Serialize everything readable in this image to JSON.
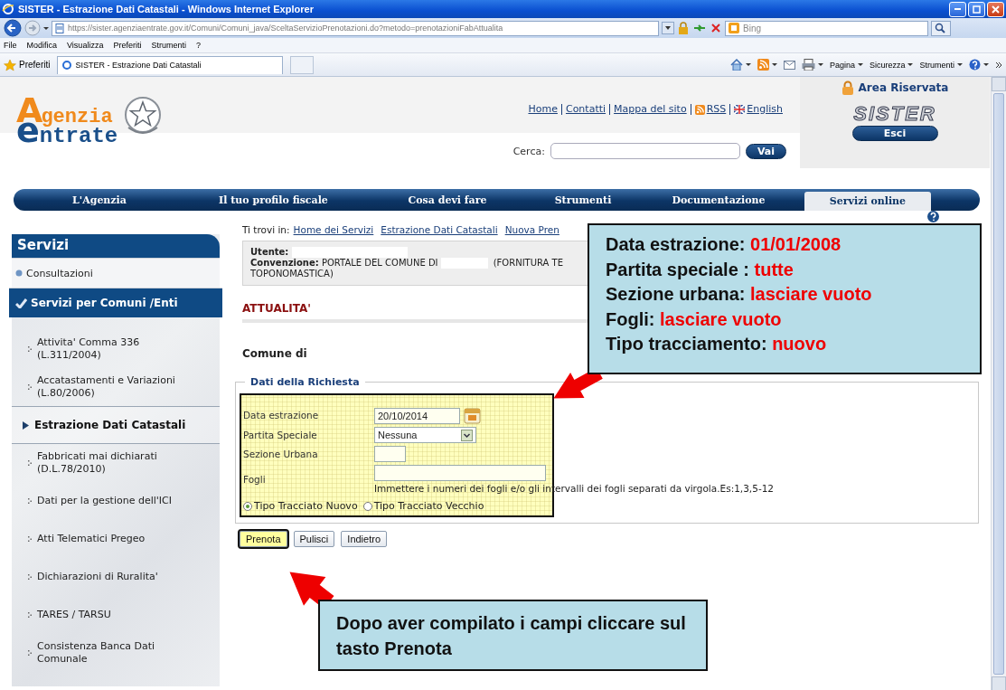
{
  "browser": {
    "title": "SISTER - Estrazione Dati Catastali - Windows Internet Explorer",
    "address": "https://sister.agenziaentrate.gov.it/Comuni/Comuni_java/SceltaServizioPrenotazioni.do?metodo=prenotazioniFabAttualita",
    "search_placeholder": "Bing",
    "menu": [
      "File",
      "Modifica",
      "Visualizza",
      "Preferiti",
      "Strumenti",
      "?"
    ],
    "favorites_label": "Preferiti",
    "tab_title": "SISTER - Estrazione Dati Catastali",
    "commands": [
      "Pagina",
      "Sicurezza",
      "Strumenti"
    ]
  },
  "header": {
    "logo": [
      "A",
      "genzia",
      "e",
      "ntrate"
    ],
    "links": [
      "Home",
      "Contatti",
      "Mappa del sito",
      "RSS",
      "English"
    ],
    "search_label": "Cerca:",
    "search_button": "Vai",
    "area_title": "Area Riservata",
    "brand": "SISTER",
    "logout": "Esci"
  },
  "nav": [
    {
      "label": "L'Agenzia",
      "selected": false
    },
    {
      "label": "Il tuo profilo fiscale",
      "selected": false
    },
    {
      "label": "Cosa devi fare",
      "selected": false
    },
    {
      "label": "Strumenti",
      "selected": false
    },
    {
      "label": "Documentazione",
      "selected": false
    },
    {
      "label": "Servizi online",
      "selected": true
    }
  ],
  "sidebar": {
    "title": "Servizi",
    "items": [
      {
        "label": "Consultazioni",
        "selected": false
      },
      {
        "label": "Servizi per Comuni /Enti",
        "selected": true,
        "children": [
          {
            "label": "Attivita' Comma 336 (L.311/2004)",
            "selected": false
          },
          {
            "label": "Accatastamenti e Variazioni (L.80/2006)",
            "selected": false
          },
          {
            "label": "Estrazione Dati Catastali",
            "selected": true
          },
          {
            "label": "Fabbricati mai dichiarati (D.L.78/2010)",
            "selected": false
          },
          {
            "label": "Dati per la gestione dell'ICI",
            "selected": false
          },
          {
            "label": "Atti Telematici Pregeo",
            "selected": false
          },
          {
            "label": "Dichiarazioni di Ruralita'",
            "selected": false
          },
          {
            "label": "TARES / TARSU",
            "selected": false
          },
          {
            "label": "Consistenza Banca Dati Comunale",
            "selected": false
          }
        ]
      }
    ]
  },
  "breadcrumb": {
    "label": "Ti trovi in:",
    "links": [
      "Home dei Servizi",
      "Estrazione Dati Catastali",
      "Nuova Pren"
    ]
  },
  "user_info": {
    "user_label": "Utente:",
    "agreement_label": "Convenzione:",
    "agreement_text": "PORTALE DEL COMUNE DI",
    "agreement_rest": "(FORNITURA TE",
    "agreement_line2": "TOPONOMASTICA)"
  },
  "section_title": "ATTUALITA'",
  "municipality_label": "Comune di",
  "form": {
    "legend": "Dati della Richiesta",
    "fields": [
      {
        "label": "Data estrazione",
        "kind": "date",
        "value": "20/10/2014"
      },
      {
        "label": "Partita Speciale",
        "kind": "select",
        "value": "Nessuna"
      },
      {
        "label": "Sezione Urbana",
        "kind": "short"
      },
      {
        "label": "Fogli",
        "kind": "long",
        "hint": "Immettere i numeri dei fogli e/o gli intervalli dei fogli separati da virgola.Es:1,3,5-12"
      }
    ],
    "radios": [
      {
        "label": "Tipo Tracciato Nuovo",
        "selected": true
      },
      {
        "label": "Tipo Tracciato Vecchio",
        "selected": false
      }
    ]
  },
  "buttons": [
    {
      "label": "Prenota",
      "focused": true
    },
    {
      "label": "Pulisci",
      "focused": false
    },
    {
      "label": "Indietro",
      "focused": false
    }
  ],
  "callouts": [
    {
      "lines": [
        {
          "label": "Data estrazione:",
          "value": "01/01/2008"
        },
        {
          "label": "Partita speciale :",
          "value": "tutte"
        },
        {
          "label": "Sezione urbana:",
          "value": "lasciare vuoto"
        },
        {
          "label": "Fogli:",
          "value": "lasciare vuoto"
        },
        {
          "label": "Tipo tracciamento:",
          "value": "nuovo"
        }
      ]
    },
    {
      "text": "Dopo aver compilato i campi cliccare sul tasto Prenota"
    }
  ]
}
